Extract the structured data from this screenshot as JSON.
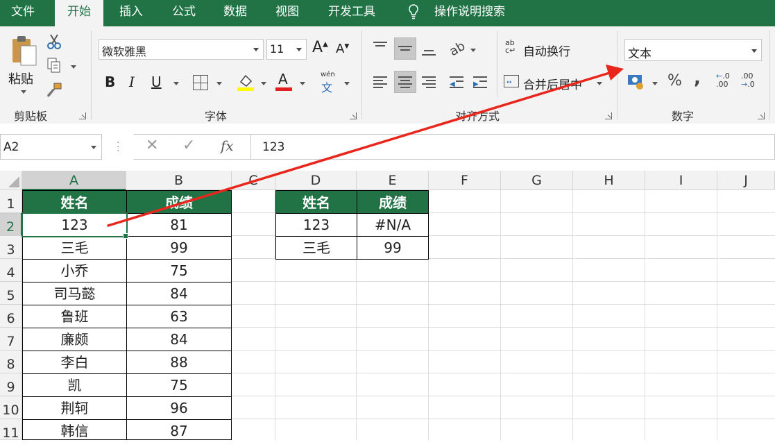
{
  "tabs": [
    {
      "label": "文件",
      "active": false
    },
    {
      "label": "开始",
      "active": true
    },
    {
      "label": "插入",
      "active": false
    },
    {
      "label": "公式",
      "active": false
    },
    {
      "label": "数据",
      "active": false
    },
    {
      "label": "视图",
      "active": false
    },
    {
      "label": "开发工具",
      "active": false
    }
  ],
  "tell_me": "操作说明搜索",
  "clipboard": {
    "paste_label": "粘贴",
    "group_label": "剪贴板"
  },
  "font": {
    "name": "微软雅黑",
    "size": "11",
    "group_label": "字体",
    "phonetic_top": "wén",
    "phonetic_bottom": "文"
  },
  "alignment": {
    "wrap_label": "自动换行",
    "merge_label": "合并后居中",
    "group_label": "对齐方式"
  },
  "number": {
    "format": "文本",
    "group_label": "数字",
    "percent": "%",
    "comma": ","
  },
  "formula_bar": {
    "name_box": "A2",
    "value": "123",
    "fx": "fx"
  },
  "columns": [
    "A",
    "B",
    "C",
    "D",
    "E",
    "F",
    "G",
    "H",
    "I",
    "J"
  ],
  "rows": [
    "1",
    "2",
    "3",
    "4",
    "5",
    "6",
    "7",
    "8",
    "9",
    "10",
    "11"
  ],
  "table1": {
    "headers": [
      "姓名",
      "成绩"
    ],
    "rows": [
      [
        "123",
        "81"
      ],
      [
        "三毛",
        "99"
      ],
      [
        "小乔",
        "75"
      ],
      [
        "司马懿",
        "84"
      ],
      [
        "鲁班",
        "63"
      ],
      [
        "廉颇",
        "84"
      ],
      [
        "李白",
        "88"
      ],
      [
        "凯",
        "75"
      ],
      [
        "荆轲",
        "96"
      ],
      [
        "韩信",
        "87"
      ]
    ]
  },
  "table2": {
    "headers": [
      "姓名",
      "成绩"
    ],
    "rows": [
      [
        "123",
        "#N/A"
      ],
      [
        "三毛",
        "99"
      ]
    ]
  },
  "colors": {
    "excel_green": "#217346",
    "annotation_arrow": "#e8261b"
  }
}
